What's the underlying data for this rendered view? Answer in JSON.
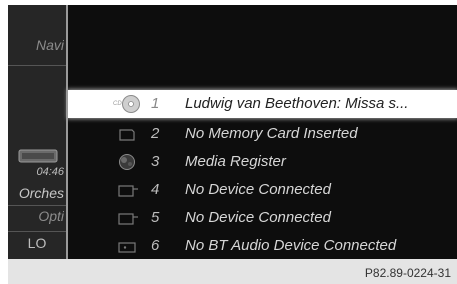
{
  "side": {
    "navi": "Navi",
    "clock": "04:46",
    "track": "Orches",
    "options": "Opti",
    "lo": "LO"
  },
  "media_list": {
    "selected_index": 0,
    "items": [
      {
        "number": "1",
        "label": "Ludwig van Beethoven: Missa s...",
        "icon": "cd-disc-icon",
        "badge": "CD"
      },
      {
        "number": "2",
        "label": "No Memory Card Inserted",
        "icon": "memory-card-icon"
      },
      {
        "number": "3",
        "label": "Media Register",
        "icon": "media-register-icon"
      },
      {
        "number": "4",
        "label": "No Device Connected",
        "icon": "usb-device-icon"
      },
      {
        "number": "5",
        "label": "No Device Connected",
        "icon": "usb-device-icon"
      },
      {
        "number": "6",
        "label": "No BT Audio Device Connected",
        "icon": "bluetooth-audio-icon"
      }
    ]
  },
  "caption": "P82.89-0224-31"
}
